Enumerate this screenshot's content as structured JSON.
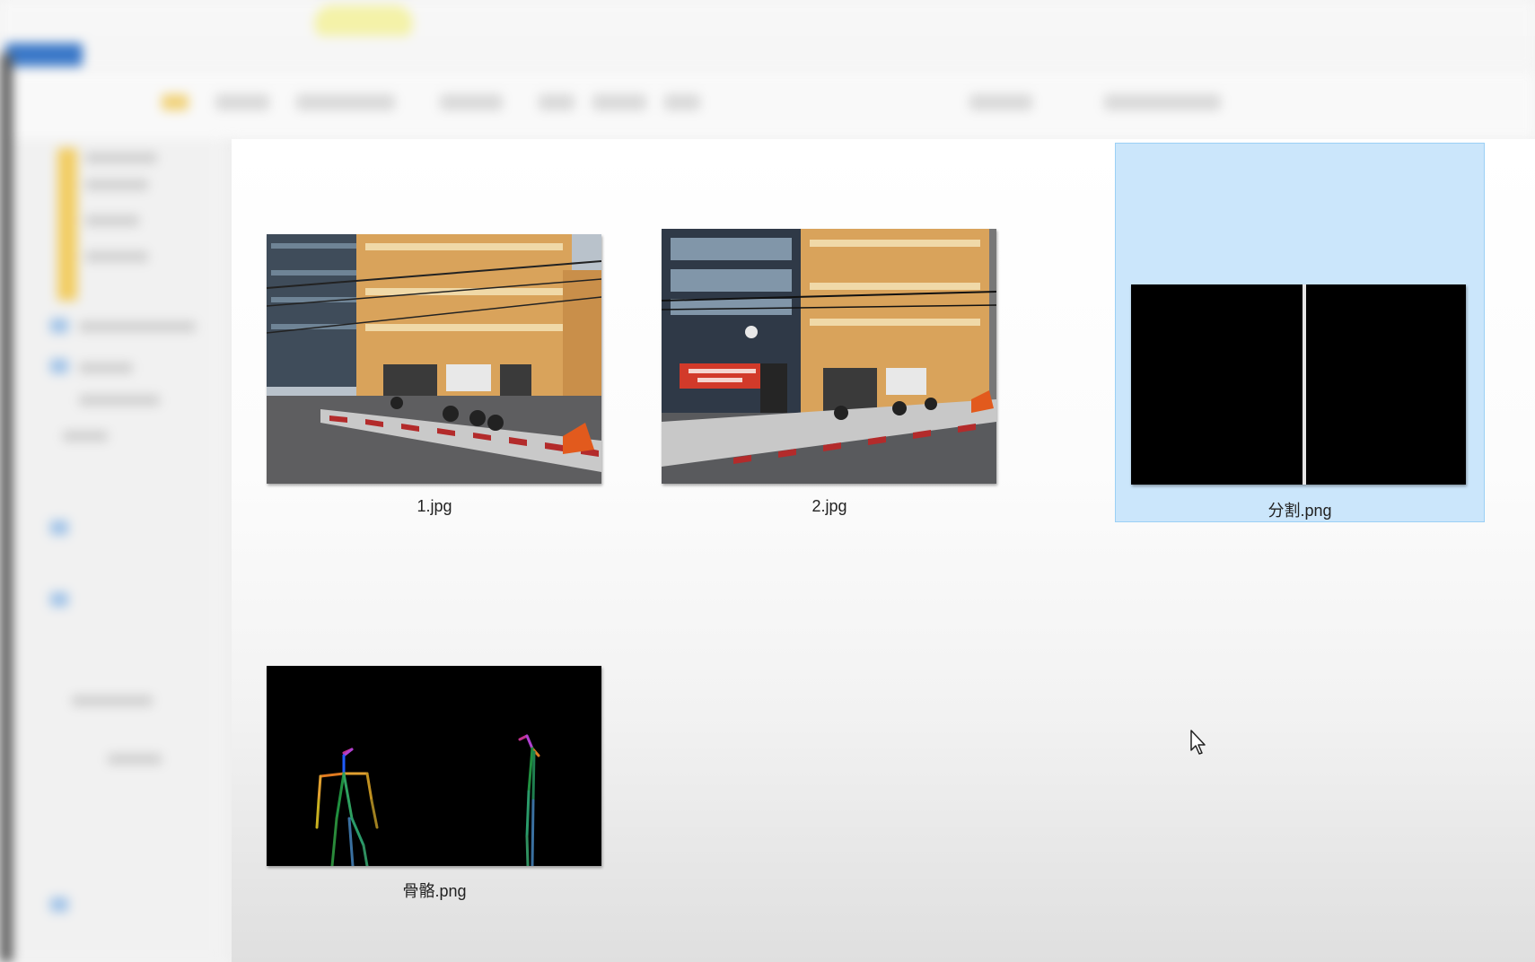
{
  "window": {
    "title": ""
  },
  "files": [
    {
      "name": "1.jpg",
      "kind": "photo-street-1"
    },
    {
      "name": "2.jpg",
      "kind": "photo-street-2"
    },
    {
      "name": "分割.png",
      "kind": "segmentation-black",
      "selected": true
    },
    {
      "name": "骨骼.png",
      "kind": "skeleton-pose"
    }
  ],
  "colors": {
    "selection_bg": "#cbe6fb",
    "selection_border": "#9bd0f5",
    "building": "#d9a35b",
    "black": "#000000"
  },
  "pointer": {
    "icon": "arrow-cursor-icon"
  }
}
